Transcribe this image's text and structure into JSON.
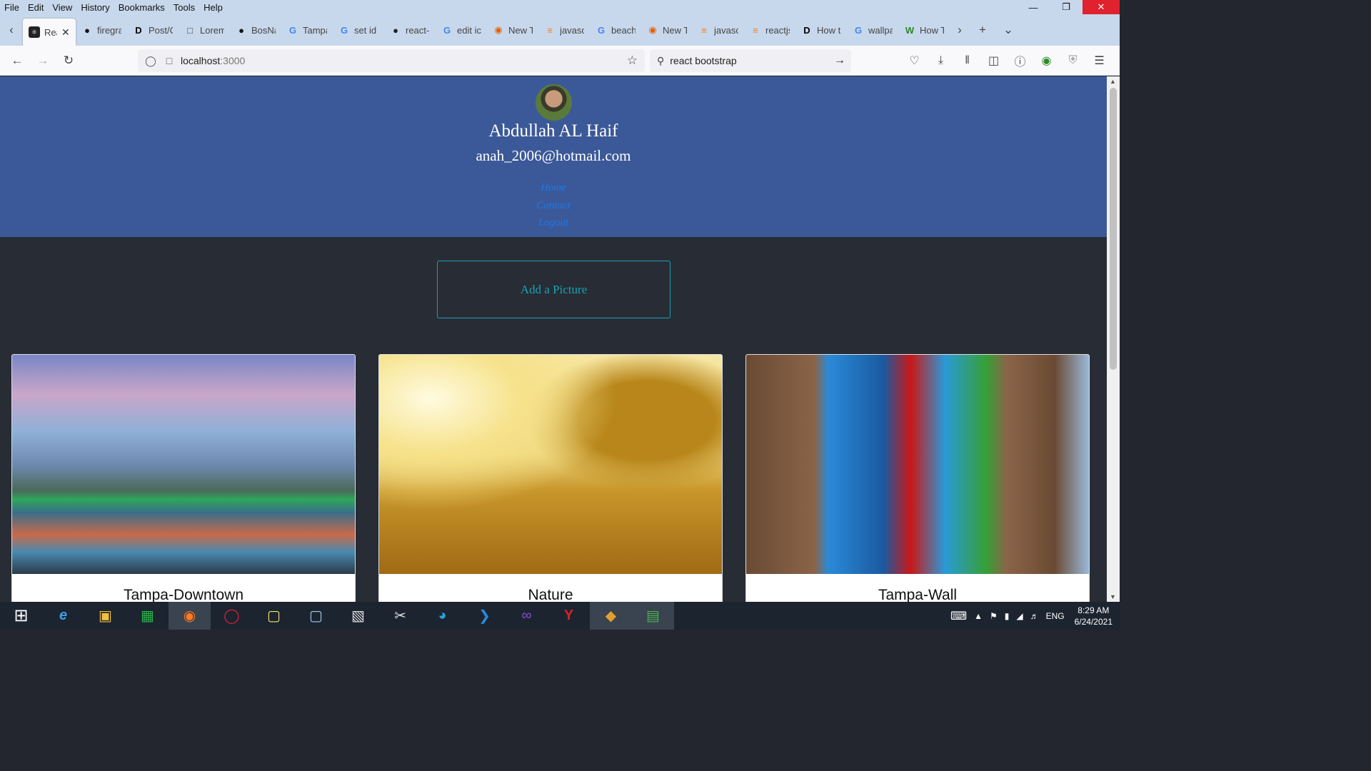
{
  "menubar": {
    "items": [
      "File",
      "Edit",
      "View",
      "History",
      "Bookmarks",
      "Tools",
      "Help"
    ]
  },
  "tabs": [
    {
      "label": "Rea",
      "icon": "react-icon",
      "color": "#222",
      "active": true
    },
    {
      "label": "firegra",
      "icon": "github-icon",
      "color": "#111"
    },
    {
      "label": "Post/C",
      "icon": "dev-icon",
      "color": "#000"
    },
    {
      "label": "Lorem",
      "icon": "page-icon",
      "color": "#444"
    },
    {
      "label": "BosNa",
      "icon": "github-icon",
      "color": "#111"
    },
    {
      "label": "Tampa",
      "icon": "google-icon",
      "color": "#4285f4"
    },
    {
      "label": "set id",
      "icon": "google-icon",
      "color": "#4285f4"
    },
    {
      "label": "react-",
      "icon": "site-icon",
      "color": "#222"
    },
    {
      "label": "edit ic",
      "icon": "google-icon",
      "color": "#4285f4"
    },
    {
      "label": "New T",
      "icon": "firefox-icon",
      "color": "#e66000"
    },
    {
      "label": "javasc",
      "icon": "stackoverflow-icon",
      "color": "#f48024"
    },
    {
      "label": "beach",
      "icon": "google-icon",
      "color": "#4285f4"
    },
    {
      "label": "New T",
      "icon": "firefox-icon",
      "color": "#e66000"
    },
    {
      "label": "javasc",
      "icon": "stackoverflow-icon",
      "color": "#f48024"
    },
    {
      "label": "reactjs",
      "icon": "stackoverflow-icon",
      "color": "#f48024"
    },
    {
      "label": "How t",
      "icon": "dev-icon",
      "color": "#000"
    },
    {
      "label": "wallpa",
      "icon": "google-icon",
      "color": "#4285f4"
    },
    {
      "label": "How T",
      "icon": "wikihow-icon",
      "color": "#2a8a2a"
    }
  ],
  "address": {
    "host": "localhost",
    "port": ":3000"
  },
  "search": {
    "value": "react bootstrap"
  },
  "profile": {
    "name": "Abdullah AL Haif",
    "email": "anah_2006@hotmail.com",
    "links": [
      "Home",
      "Contact",
      "Logout"
    ]
  },
  "add_button": "Add a Picture",
  "cards": [
    {
      "title": "Tampa-Downtown"
    },
    {
      "title": "Nature"
    },
    {
      "title": "Tampa-Wall"
    }
  ],
  "taskbar": {
    "lang": "ENG",
    "time": "8:29 AM",
    "date": "6/24/2021"
  }
}
